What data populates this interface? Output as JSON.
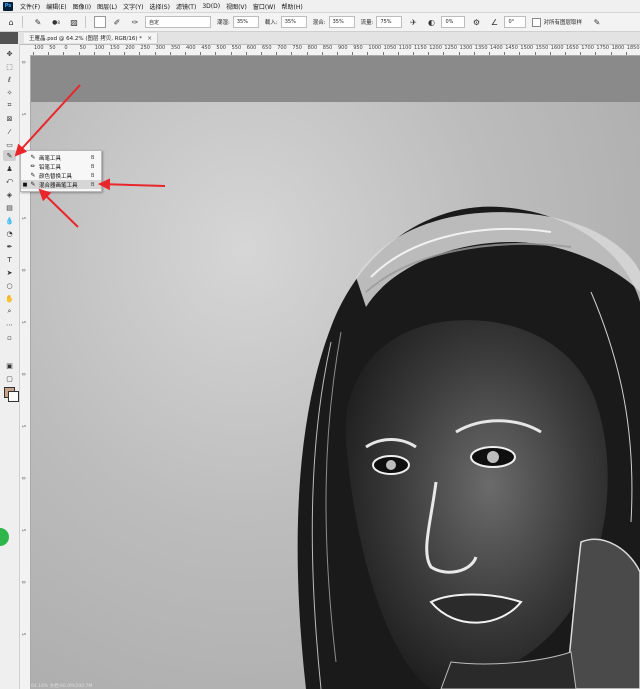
{
  "menu": [
    "文件(F)",
    "编辑(E)",
    "图像(I)",
    "图层(L)",
    "文字(Y)",
    "选择(S)",
    "滤镜(T)",
    "3D(D)",
    "视图(V)",
    "窗口(W)",
    "帮助(H)"
  ],
  "logo": "Ps",
  "options": {
    "brush_size": "8",
    "mode": "自定",
    "wet_label": "潮湿:",
    "wet_value": "35%",
    "load_label": "载入:",
    "load_value": "35%",
    "mix_label": "混合:",
    "mix_value": "35%",
    "flow_label": "流量:",
    "flow_value": "75%",
    "smoothing_value": "0%",
    "angle_value": "0°",
    "sample_all_label": "对所有图层取样"
  },
  "document": {
    "tab_title": "王雁晶.psd @ 64.2% (图层 拷贝, RGB/16) *",
    "close": "×"
  },
  "ruler_top": [
    "100",
    "50",
    "0",
    "50",
    "100",
    "150",
    "200",
    "250",
    "300",
    "350",
    "400",
    "450",
    "500",
    "550",
    "600",
    "650",
    "700",
    "750",
    "800",
    "850",
    "900",
    "950",
    "1000",
    "1050",
    "1100",
    "1150",
    "1200",
    "1250",
    "1300",
    "1350",
    "1400",
    "1450",
    "1500",
    "1550",
    "1600",
    "1650",
    "1700",
    "1750",
    "1800",
    "1850",
    "1900",
    "1950"
  ],
  "ruler_left": [
    "0",
    "5",
    "0",
    "5",
    "0",
    "5",
    "0",
    "5",
    "0",
    "5",
    "0",
    "5"
  ],
  "tools": [
    "move-icon",
    "marquee-icon",
    "lasso-icon",
    "quick-select-icon",
    "crop-icon",
    "frame-icon",
    "eyedropper-icon",
    "healing-icon",
    "brush-icon",
    "stamp-icon",
    "history-brush-icon",
    "eraser-icon",
    "gradient-icon",
    "blur-icon",
    "dodge-icon",
    "pen-icon",
    "type-icon",
    "path-select-icon",
    "shape-icon",
    "hand-icon",
    "zoom-icon",
    "more-icon"
  ],
  "flyout": [
    {
      "label": "画笔工具",
      "key": "B",
      "selected": false,
      "bullet": ""
    },
    {
      "label": "铅笔工具",
      "key": "B",
      "selected": false,
      "bullet": ""
    },
    {
      "label": "颜色替换工具",
      "key": "B",
      "selected": false,
      "bullet": ""
    },
    {
      "label": "混合器画笔工具",
      "key": "B",
      "selected": true,
      "bullet": "■"
    }
  ],
  "colors": {
    "foreground": "#c8a389",
    "background": "#ffffff",
    "arrow": "#e8262b"
  },
  "status": "64.18%   文档:66.0M/200.7M"
}
